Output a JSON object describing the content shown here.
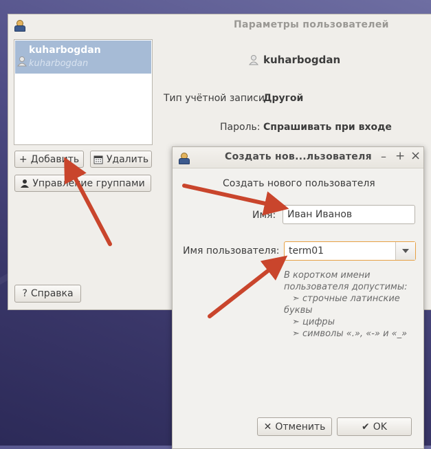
{
  "main_window": {
    "title": "Параметры пользователей",
    "user_list": [
      {
        "name": "kuharbogdan",
        "subtitle": "kuharbogdan"
      }
    ],
    "buttons": {
      "add": "Добавить",
      "delete": "Удалить",
      "manage_groups": "Управление группами",
      "help": "Справка"
    },
    "details": {
      "username": "kuharbogdan",
      "account_type_label": "Тип учётной записи:",
      "account_type_value": "Другой",
      "password_label": "Пароль:",
      "password_value": "Спрашивать при входе"
    }
  },
  "dialog": {
    "title": "Создать нов...льзователя",
    "heading": "Создать нового пользователя",
    "name_label": "Имя:",
    "name_value": "Иван Иванов",
    "username_label": "Имя пользователя:",
    "username_value": "term01",
    "hint_line1": "В коротком имени",
    "hint_line2": "пользователя допустимы:",
    "hint_item1_a": "➣ строчные латинские",
    "hint_item1_b": "буквы",
    "hint_item2": "➣ цифры",
    "hint_item3": "➣ символы «.», «-» и «_»",
    "cancel": "Отменить",
    "ok": "OK",
    "controls": {
      "minimize": "–",
      "maximize": "+",
      "close": "×"
    }
  },
  "colors": {
    "annotation_arrow": "#c9452c",
    "selection": "#a6bbd6"
  }
}
